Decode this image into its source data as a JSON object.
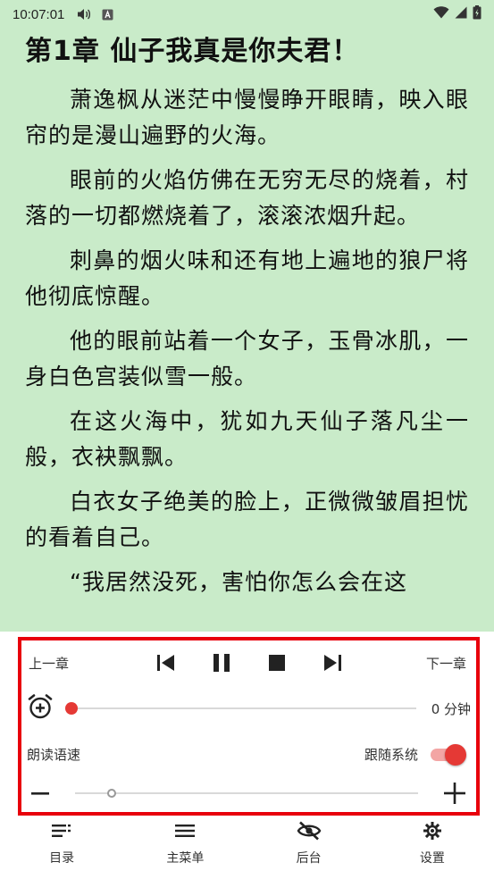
{
  "status_bar": {
    "time": "10:07:01"
  },
  "reader": {
    "chapter_title": "第1章 仙子我真是你夫君！",
    "paragraphs": [
      "萧逸枫从迷茫中慢慢睁开眼睛，映入眼帘的是漫山遍野的火海。",
      "眼前的火焰仿佛在无穷无尽的烧着，村落的一切都燃烧着了，滚滚浓烟升起。",
      "刺鼻的烟火味和还有地上遍地的狼尸将他彻底惊醒。",
      "他的眼前站着一个女子，玉骨冰肌，一身白色宫装似雪一般。",
      "在这火海中，犹如九天仙子落凡尘一般，衣袂飘飘。",
      "白衣女子绝美的脸上，正微微皱眉担忧的看着自己。",
      "“我居然没死，害怕你怎么会在这"
    ]
  },
  "controls": {
    "prev_chapter": "上一章",
    "next_chapter": "下一章",
    "timer_value": "0 分钟",
    "speech_speed_label": "朗读语速",
    "follow_system_label": "跟随系统",
    "follow_system_on": true,
    "timer_minutes": 0
  },
  "bottom_nav": {
    "items": [
      {
        "label": "目录",
        "icon": "toc-icon"
      },
      {
        "label": "主菜单",
        "icon": "menu-icon"
      },
      {
        "label": "后台",
        "icon": "eye-off-icon"
      },
      {
        "label": "设置",
        "icon": "gear-icon"
      }
    ]
  },
  "colors": {
    "reader_background": "#c9ebc9",
    "accent": "#e53935",
    "highlight_border": "#e8000b"
  }
}
